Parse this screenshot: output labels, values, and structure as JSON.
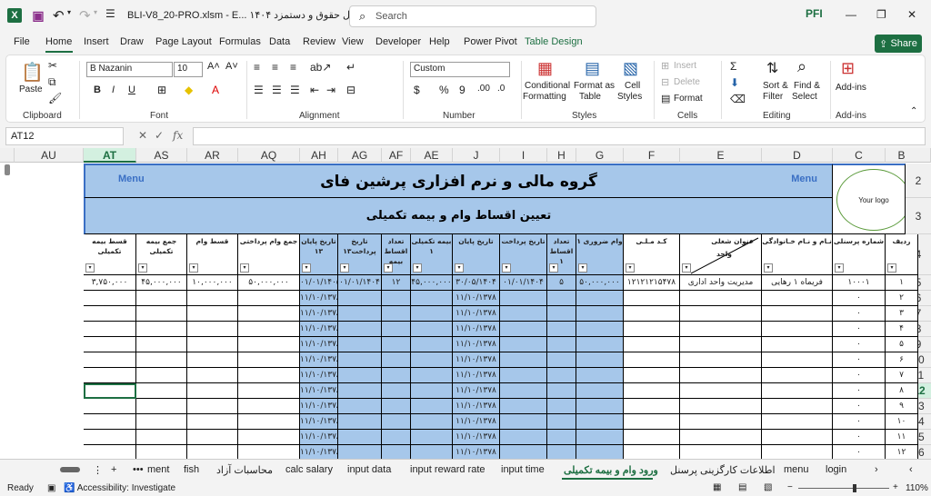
{
  "titlebar": {
    "excel_icon": "X",
    "doc_title": "BLI-V8_20-PRO.xlsm - E... اکسل حقوق و دستمزد ۱۴۰۴",
    "search_placeholder": "Search",
    "brand": "PFI"
  },
  "menu": {
    "tabs": [
      "File",
      "Home",
      "Insert",
      "Draw",
      "Page Layout",
      "Formulas",
      "Data",
      "Review",
      "View",
      "Developer",
      "Help",
      "Power Pivot",
      "Table Design"
    ],
    "share": "Share"
  },
  "ribbon": {
    "clipboard": {
      "paste": "Paste",
      "label": "Clipboard"
    },
    "font": {
      "name": "B Nazanin",
      "size": "10",
      "label": "Font"
    },
    "alignment": {
      "label": "Alignment"
    },
    "number": {
      "format": "Custom",
      "label": "Number"
    },
    "styles": {
      "conditional": "Conditional",
      "conditional2": "Formatting",
      "format_as": "Format as",
      "format_as2": "Table",
      "cell_styles": "Cell",
      "cell_styles2": "Styles",
      "label": "Styles"
    },
    "cells": {
      "insert": "Insert",
      "delete": "Delete",
      "format": "Format",
      "label": "Cells"
    },
    "editing": {
      "sort": "Sort &",
      "sort2": "Filter",
      "find": "Find &",
      "find2": "Select",
      "label": "Editing"
    },
    "addins": {
      "btn": "Add-ins",
      "label": "Add-ins"
    }
  },
  "formula_bar": {
    "name_box": "AT12",
    "fx": "fx",
    "value": ""
  },
  "columns": [
    {
      "id": "AU",
      "w": 76
    },
    {
      "id": "AT",
      "w": 58
    },
    {
      "id": "AS",
      "w": 56
    },
    {
      "id": "AR",
      "w": 56
    },
    {
      "id": "AQ",
      "w": 68
    },
    {
      "id": "AH",
      "w": 42
    },
    {
      "id": "AG",
      "w": 48
    },
    {
      "id": "AF",
      "w": 32
    },
    {
      "id": "AE",
      "w": 46
    },
    {
      "id": "J",
      "w": 52
    },
    {
      "id": "I",
      "w": 52
    },
    {
      "id": "H",
      "w": 32
    },
    {
      "id": "G",
      "w": 52
    },
    {
      "id": "F",
      "w": 62
    },
    {
      "id": "E",
      "w": 90
    },
    {
      "id": "D",
      "w": 78
    },
    {
      "id": "C",
      "w": 58
    },
    {
      "id": "B",
      "w": 36
    }
  ],
  "selected_column": "AT",
  "rows": [
    "2",
    "3",
    "4",
    "5",
    "6",
    "7",
    "8",
    "9",
    "10",
    "11",
    "12",
    "13",
    "14",
    "15",
    "16"
  ],
  "selected_row": "12",
  "sheet": {
    "company_title": "گروه مالی و نرم افزاری پرشین فای",
    "subtitle": "تعیین اقساط وام و بیمه تکمیلی",
    "menu_left": "Menu",
    "menu_right": "Menu",
    "logo_text": "Your logo",
    "headers": {
      "AT": "قسط بیمه تکمیلی",
      "AS": "جمع بیمه تکمیلی",
      "AR": "قسط وام",
      "AQ": "جمع وام پرداختی",
      "AH": "تاریخ پایان ۱۳",
      "AG": "تاریخ پرداخت۱۳",
      "AF": "تعداد اقساط بیمه",
      "AE": "بیمه تکمیلی ۱",
      "J": "تاریخ پایان",
      "I": "تاریخ پرداخت",
      "H": "تعداد اقساط ۱",
      "G": "وام ضروری ۱",
      "F": "کـد مـلـی",
      "E1": "عنوان شغلی",
      "E2": "واحد",
      "D": "نـام و نـام خـانوادگی",
      "C": "شماره پرسنلی",
      "B": "ردیف"
    },
    "row5": {
      "AT": "۳,۷۵۰,۰۰۰",
      "AS": "۴۵,۰۰۰,۰۰۰",
      "AR": "۱۰,۰۰۰,۰۰۰",
      "AQ": "۵۰,۰۰۰,۰۰۰",
      "AH": "۰۱/۰۱/۱۴۰۵",
      "AG": "۰۱/۰۱/۱۴۰۴",
      "AF": "۱۲",
      "AE": "۴۵,۰۰۰,۰۰۰",
      "J": "۳۰/۰۵/۱۴۰۴",
      "I": "۰۱/۰۱/۱۴۰۴",
      "H": "۵",
      "G": "۵۰,۰۰۰,۰۰۰",
      "F": "۱۲۱۲۱۲۱۵۴۷۸",
      "E": "مدیریت   واحد اداری",
      "D": "فریماه ۱ رهایی",
      "C": "۱۰۰۰۱",
      "B": "۱"
    },
    "empty_date": "۱۱/۱۰/۱۳۷۸",
    "zero": "۰",
    "row_numbers": [
      "۲",
      "۳",
      "۴",
      "۵",
      "۶",
      "۷",
      "۸",
      "۹",
      "۱۰",
      "۱۱",
      "۱۲"
    ]
  },
  "sheet_tabs": [
    "ment",
    "fish",
    "محاسبات آزاد",
    "calc salary",
    "input data",
    "input reward rate",
    "input time",
    "ورود وام و بیمه تکمیلی",
    "اطلاعات کارگزینی پرسنل",
    "menu",
    "login"
  ],
  "active_tab": "ورود وام و بیمه تکمیلی",
  "status": {
    "ready": "Ready",
    "accessibility": "Accessibility: Investigate",
    "zoom": "110%"
  }
}
